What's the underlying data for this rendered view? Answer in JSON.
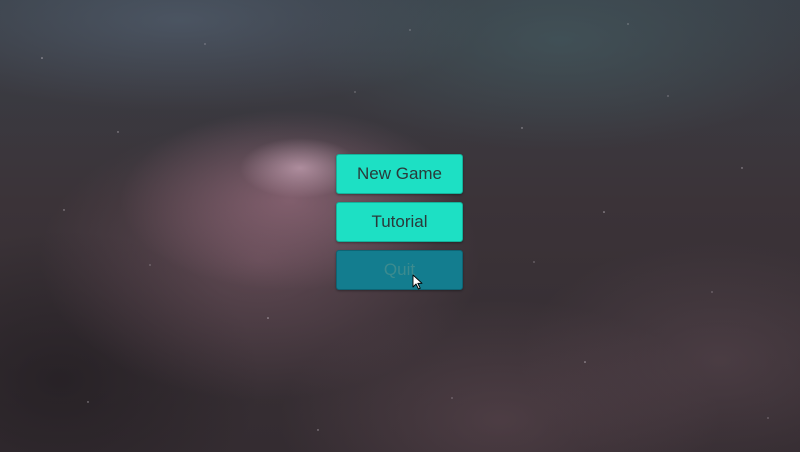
{
  "menu": {
    "new_game_label": "New Game",
    "tutorial_label": "Tutorial",
    "quit_label": "Quit",
    "hovered_item": "Quit"
  },
  "colors": {
    "button_normal": "#1de0c4",
    "button_hover": "#137d8f",
    "button_text": "#2a3a3a"
  },
  "icons": {
    "cursor": "mouse-pointer-icon"
  }
}
